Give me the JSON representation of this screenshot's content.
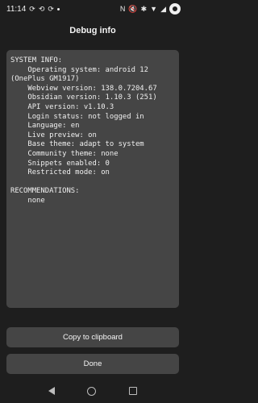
{
  "status_bar": {
    "time": "11:14",
    "left_icons": [
      "sync-icon",
      "sync-icon",
      "sync-icon",
      "dot-icon"
    ],
    "right_icons": [
      "nfc-icon",
      "mute-icon",
      "bluetooth-icon",
      "wifi-icon",
      "signal-icon",
      "battery-icon"
    ]
  },
  "header": {
    "title": "Debug info"
  },
  "debug": {
    "text": "SYSTEM INFO:\n    Operating system: android 12\n(OnePlus GM1917)\n    Webview version: 138.0.7204.67\n    Obsidian version: 1.10.3 (251)\n    API version: v1.10.3\n    Login status: not logged in\n    Language: en\n    Live preview: on\n    Base theme: adapt to system\n    Community theme: none\n    Snippets enabled: 0\n    Restricted mode: on\n\nRECOMMENDATIONS:\n    none"
  },
  "actions": {
    "copy_label": "Copy to clipboard",
    "done_label": "Done"
  },
  "nav": {
    "icons": [
      "back-icon",
      "home-icon",
      "recents-icon"
    ]
  }
}
